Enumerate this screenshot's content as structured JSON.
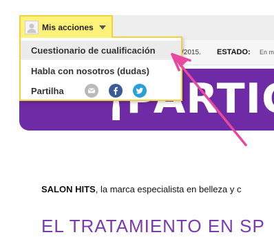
{
  "menu": {
    "trigger_label": "Mis acciones",
    "items": [
      {
        "label": "Cuestionario de cualificación"
      },
      {
        "label": "Habla con nosotros (dudas)"
      },
      {
        "label": "Partilha"
      }
    ],
    "share_icons": [
      "email-icon",
      "facebook-icon",
      "twitter-icon"
    ]
  },
  "info": {
    "date_fragment": "/2015.",
    "estado_label": "ESTADO:",
    "estado_value": "En m"
  },
  "banner": {
    "text": "¡PARTIC",
    "color": "#6f2aa6"
  },
  "body": {
    "brand": "SALON HITS",
    "intro": ", la marca especialista en belleza y c",
    "heading": "EL TRATAMIENTO EN SP"
  },
  "colors": {
    "menu_highlight": "#fff27a",
    "menu_border": "#f1d23c",
    "arrow": "#e8489e"
  }
}
